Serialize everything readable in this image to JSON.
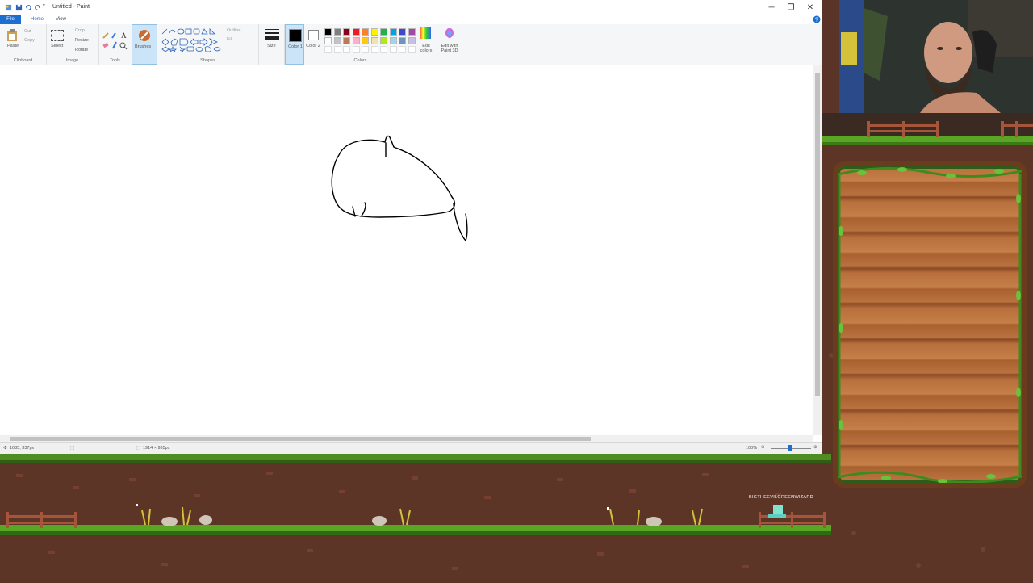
{
  "window": {
    "title": "Untitled - Paint",
    "controls": {
      "minimize": "─",
      "maximize": "❐",
      "close": "✕"
    }
  },
  "tabs": {
    "file": "File",
    "home": "Home",
    "view": "View"
  },
  "ribbon": {
    "clipboard": {
      "paste": "Paste",
      "cut": "Cut",
      "copy": "Copy",
      "label": "Clipboard"
    },
    "image": {
      "select": "Select",
      "crop": "Crop",
      "resize": "Resize",
      "rotate": "Rotate",
      "label": "Image"
    },
    "tools": {
      "label": "Tools"
    },
    "brushes": {
      "label": "Brushes"
    },
    "shapes": {
      "outline": "Outline",
      "fill": "Fill",
      "label": "Shapes"
    },
    "size": {
      "label": "Size"
    },
    "color1": {
      "label": "Color 1"
    },
    "color2": {
      "label": "Color 2"
    },
    "colors": {
      "edit": "Edit colors",
      "label": "Colors"
    },
    "paint3d": {
      "label": "Edit with Paint 3D"
    }
  },
  "palette": [
    "#000000",
    "#7f7f7f",
    "#880015",
    "#ed1c24",
    "#ff7f27",
    "#fff200",
    "#22b14c",
    "#00a2e8",
    "#3f48cc",
    "#a349a4",
    "#ffffff",
    "#c3c3c3",
    "#b97a57",
    "#ffaec9",
    "#ffc90e",
    "#efe4b0",
    "#b5e61d",
    "#99d9ea",
    "#7092be",
    "#c8bfe7"
  ],
  "status": {
    "cursor": "1085, 337px",
    "canvas_size": "1914 × 935px",
    "zoom": "100%"
  },
  "stream": {
    "chat_username": "BIGTHEEVILGREENWIZARD"
  }
}
